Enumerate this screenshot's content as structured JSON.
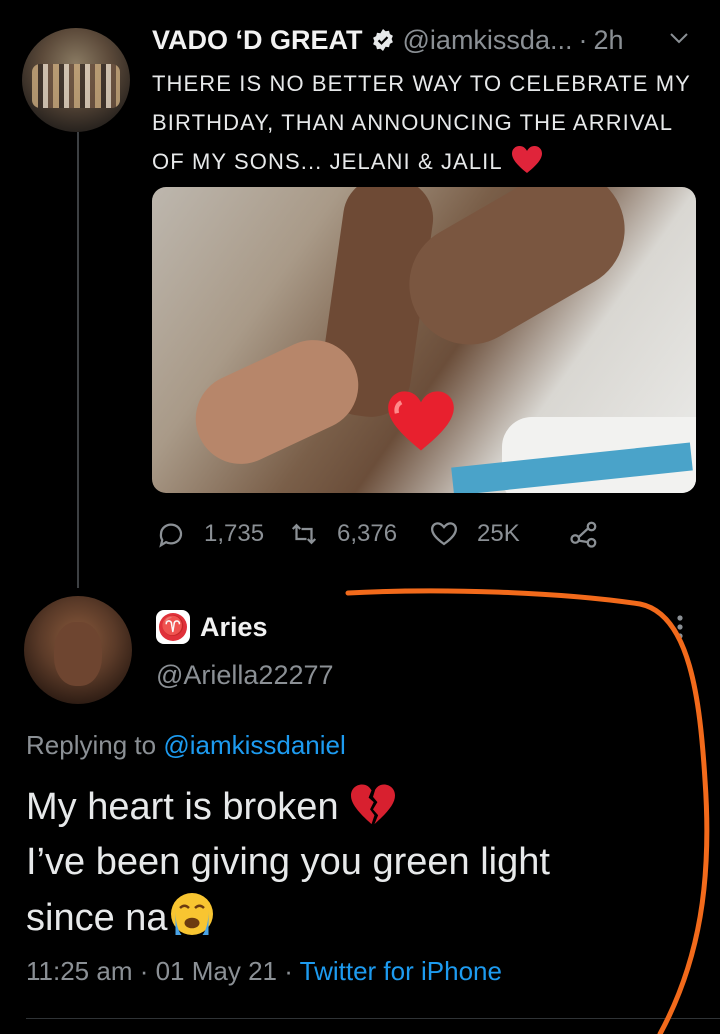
{
  "tweet": {
    "display_name": "VADO ‘D GREAT",
    "handle": "@iamkissda...",
    "separator": "·",
    "time": "2h",
    "text_lines": [
      "THERE IS NO BETTER WAY TO CELEBRATE MY",
      "BIRTHDAY, THAN ANNOUNCING THE ARRIVAL",
      "OF MY SONS... JELANI & JALIL"
    ],
    "media_icon": "photo-image",
    "actions": {
      "replies": "1,735",
      "retweets": "6,376",
      "likes": "25K"
    }
  },
  "reply": {
    "display_name": "Aries",
    "handle": "@Ariella22277",
    "replying_prefix": "Replying to ",
    "replying_to": "@iamkissdaniel",
    "body_lines": [
      "My heart is broken",
      "I’ve been giving you green light",
      "since na"
    ],
    "timestamp": "11:25 am",
    "meta_sep": " · ",
    "date": "01 May 21",
    "source": "Twitter for iPhone"
  },
  "colors": {
    "background": "#000000",
    "link": "#1d9bf0",
    "muted": "#8b9095",
    "annotation": "#f26a1b",
    "heart": "#e0243a"
  }
}
